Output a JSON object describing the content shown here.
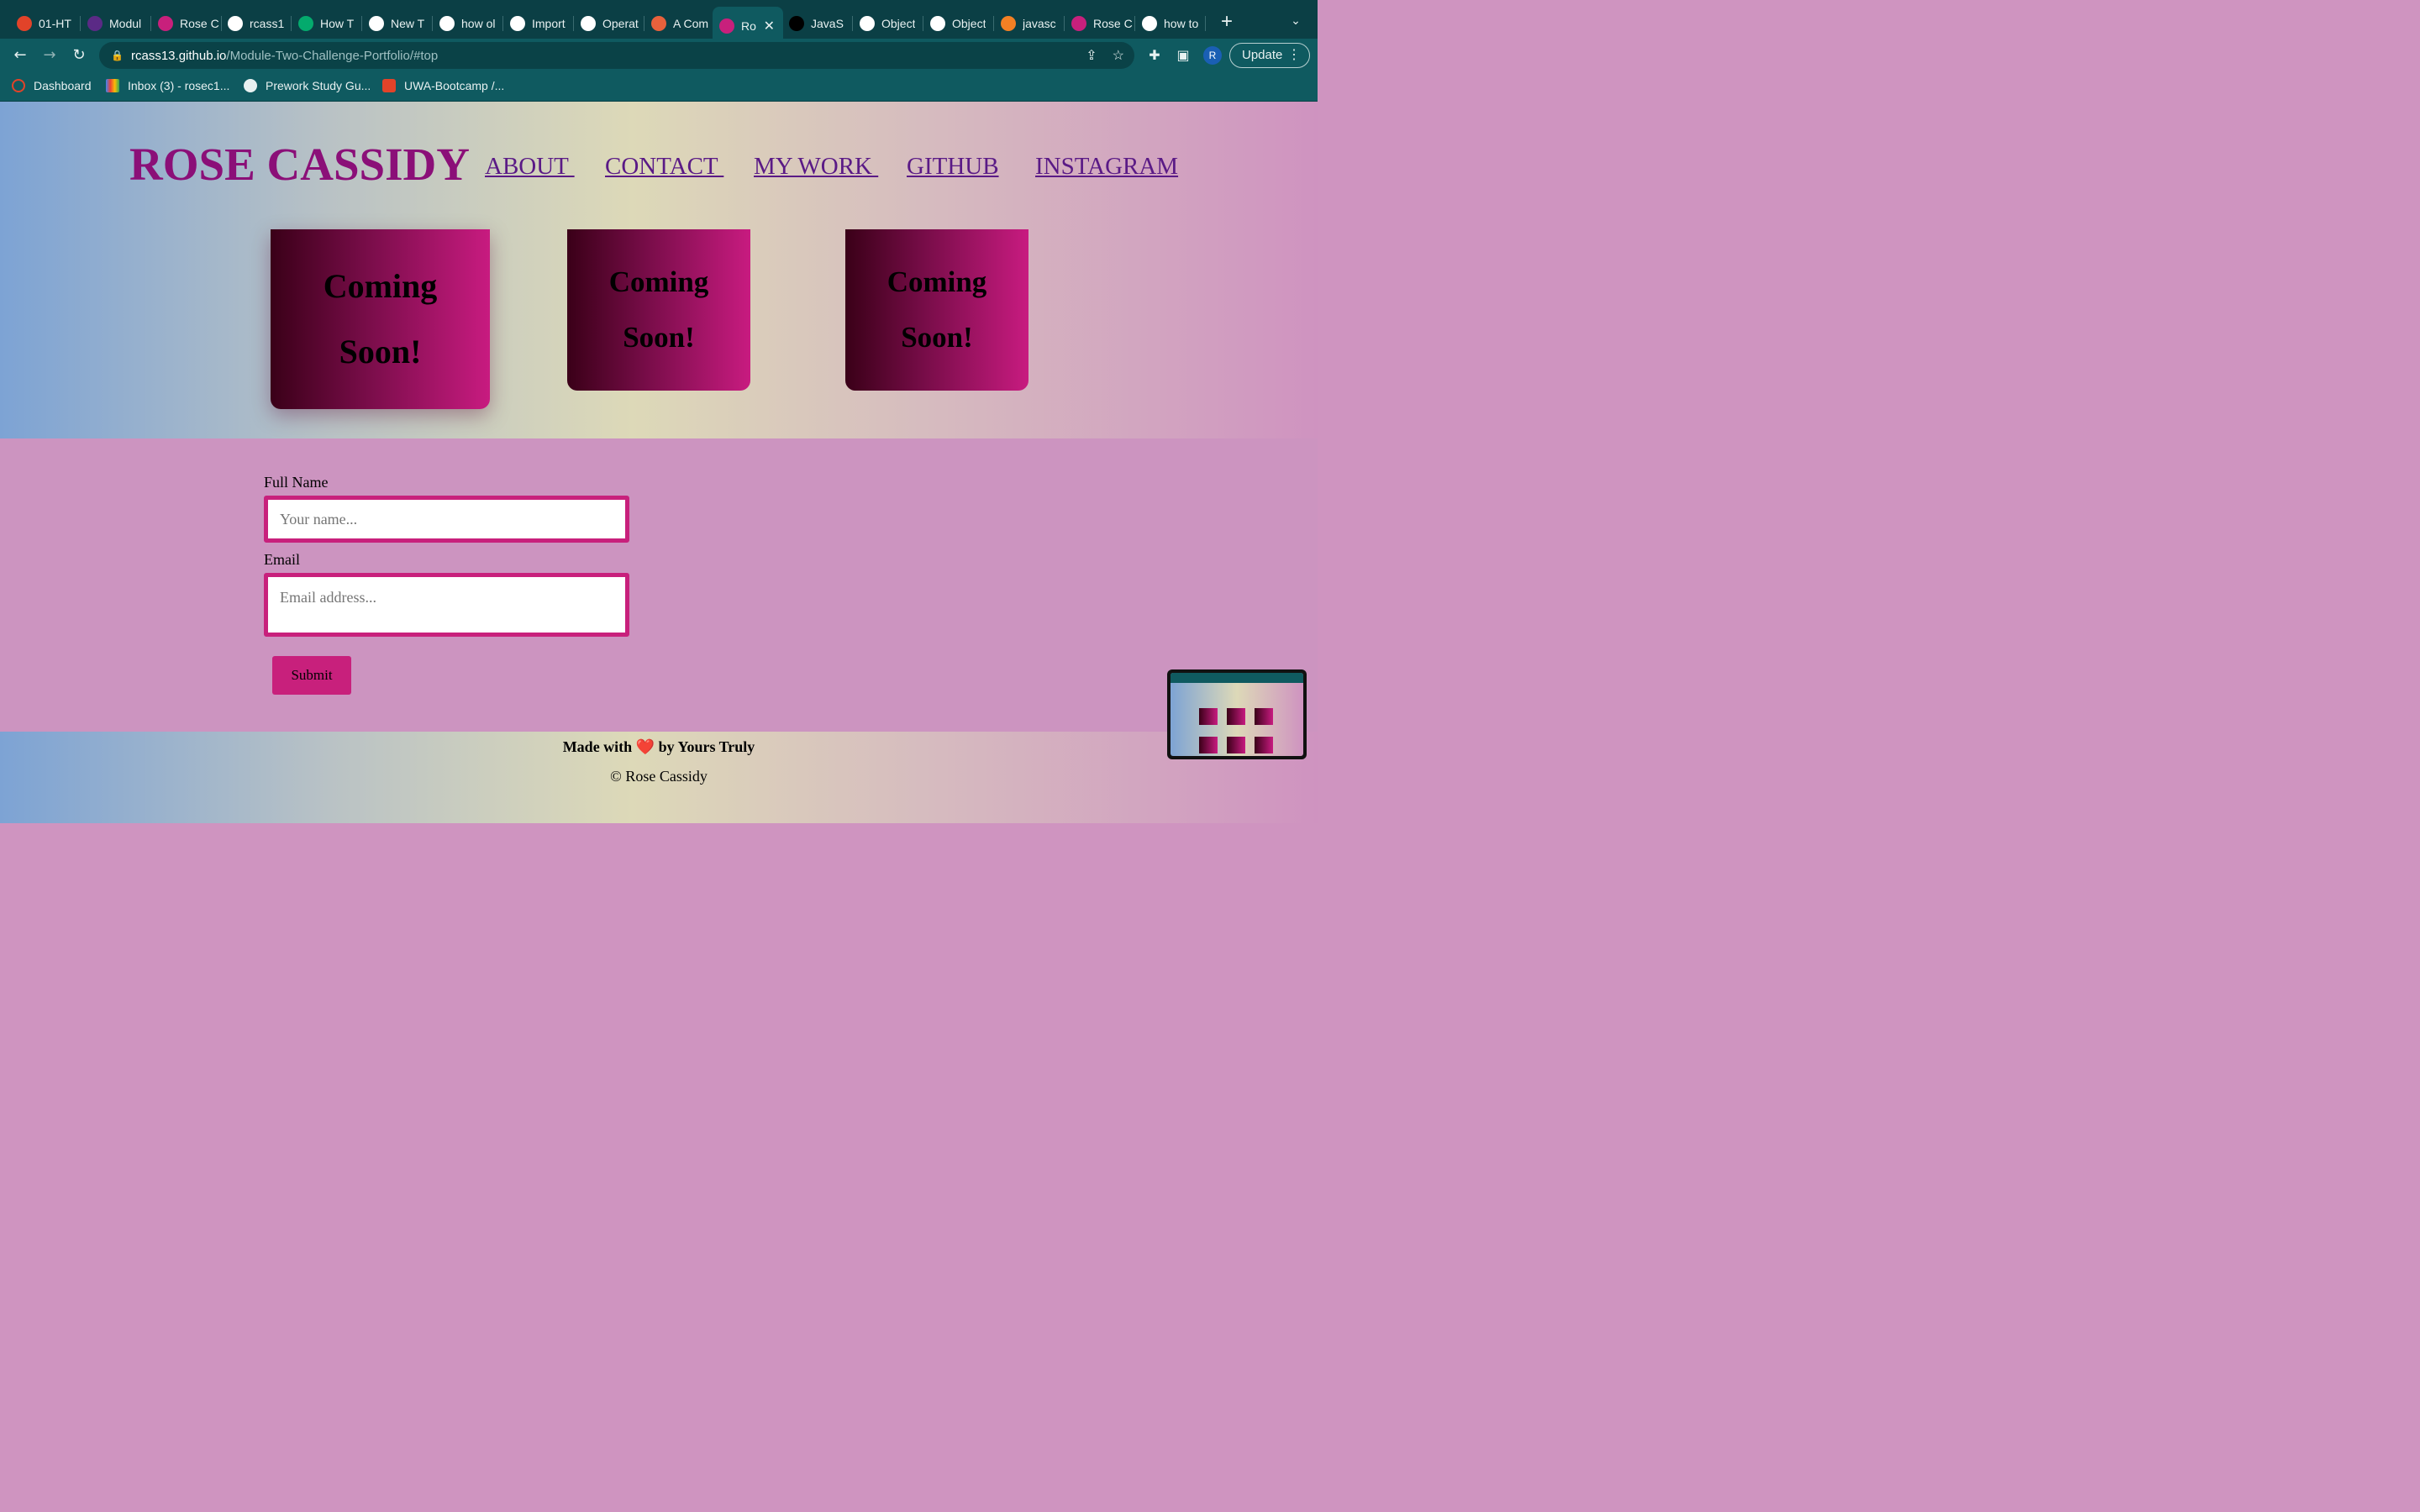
{
  "browser": {
    "tabs": [
      {
        "label": "01-HT",
        "icon": "gitlab-icon",
        "color": "#e24329"
      },
      {
        "label": "Modul",
        "icon": "w-icon",
        "color": "#5b2a86"
      },
      {
        "label": "Rose C",
        "icon": "profile-photo-icon",
        "color": "#c8207c"
      },
      {
        "label": "rcass1",
        "icon": "github-icon",
        "color": "#ffffff"
      },
      {
        "label": "How T",
        "icon": "w3-icon",
        "color": "#04aa6d"
      },
      {
        "label": "New T",
        "icon": "chrome-icon",
        "color": "#ffffff"
      },
      {
        "label": "how ol",
        "icon": "google-icon",
        "color": "#ffffff"
      },
      {
        "label": "Import",
        "icon": "globe-icon",
        "color": "#ffffff"
      },
      {
        "label": "Operat",
        "icon": "globe-icon",
        "color": "#ffffff"
      },
      {
        "label": "A Com",
        "icon": "asterisk-icon",
        "color": "#e8613c"
      },
      {
        "label": "Ro",
        "icon": "profile-photo-icon",
        "color": "#c8207c",
        "active": true
      },
      {
        "label": "JavaS",
        "icon": "u-icon",
        "color": "#000000"
      },
      {
        "label": "Object",
        "icon": "globe-icon",
        "color": "#ffffff"
      },
      {
        "label": "Object",
        "icon": "globe-icon",
        "color": "#ffffff"
      },
      {
        "label": "javasc",
        "icon": "stackoverflow-icon",
        "color": "#f48024"
      },
      {
        "label": "Rose C",
        "icon": "profile-photo-icon",
        "color": "#c8207c"
      },
      {
        "label": "how to",
        "icon": "google-icon",
        "color": "#ffffff"
      }
    ],
    "url_host": "rcass13.github.io",
    "url_path": "/Module-Two-Challenge-Portfolio/#top",
    "profile_initial": "R",
    "update_label": "Update",
    "bookmarks": [
      {
        "label": "Dashboard",
        "icon": "dashboard-icon"
      },
      {
        "label": "Inbox (3) - rosec1...",
        "icon": "gmail-icon"
      },
      {
        "label": "Prework Study Gu...",
        "icon": "globe-icon"
      },
      {
        "label": "UWA-Bootcamp /...",
        "icon": "gitlab-icon"
      }
    ]
  },
  "site": {
    "title": "ROSE CASSIDY",
    "nav": [
      "ABOUT ",
      "CONTACT ",
      "MY WORK ",
      "GITHUB",
      "INSTAGRAM"
    ],
    "cards": [
      {
        "line1": "Coming",
        "line2": "Soon!"
      },
      {
        "line1": "Coming",
        "line2": "Soon!"
      },
      {
        "line1": "Coming",
        "line2": "Soon!"
      }
    ],
    "form": {
      "name_label": "Full Name",
      "name_placeholder": "Your name...",
      "email_label": "Email",
      "email_placeholder": "Email address...",
      "submit_label": "Submit"
    },
    "footer": {
      "made_prefix": "Made with",
      "heart": "❤️",
      "made_suffix": "by Yours Truly",
      "copyright": "© Rose Cassidy"
    }
  },
  "colors": {
    "title": "#8b0f78",
    "nav": "#5a1a86",
    "accent": "#c8207c",
    "chrome": "#0f5a60"
  }
}
